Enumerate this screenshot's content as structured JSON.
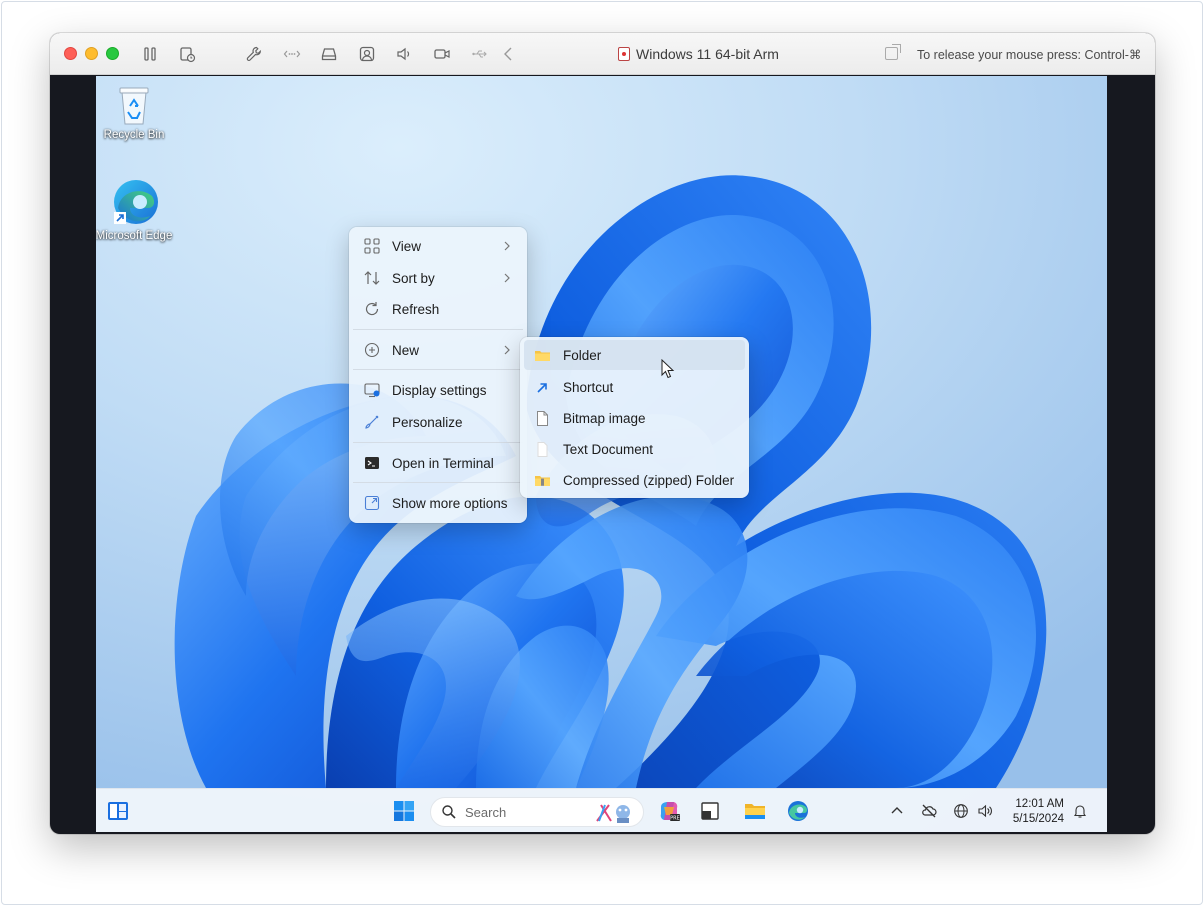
{
  "window": {
    "title": "Windows 11 64-bit Arm",
    "release_hint": "To release your mouse press: Control-⌘",
    "toolbar_icons": [
      "pause-icon",
      "snapshot-icon",
      "settings-wrench-icon",
      "network-icon",
      "disk-icon",
      "camera-sharing-icon",
      "sound-icon",
      "video-camera-icon",
      "usb-icon",
      "back-chevron-icon"
    ]
  },
  "desktop": {
    "icons": [
      {
        "label": "Recycle Bin",
        "icon": "recycle-bin-icon"
      },
      {
        "label": "Microsoft Edge",
        "icon": "edge-icon"
      }
    ]
  },
  "context_menu": {
    "items": [
      {
        "label": "View",
        "icon": "grid-view-icon",
        "has_submenu": true
      },
      {
        "label": "Sort by",
        "icon": "sort-icon",
        "has_submenu": true
      },
      {
        "label": "Refresh",
        "icon": "refresh-icon",
        "has_submenu": false
      },
      {
        "label": "New",
        "icon": "plus-circle-icon",
        "has_submenu": true
      },
      {
        "label": "Display settings",
        "icon": "display-icon",
        "has_submenu": false
      },
      {
        "label": "Personalize",
        "icon": "brush-icon",
        "has_submenu": false
      },
      {
        "label": "Open in Terminal",
        "icon": "terminal-icon",
        "has_submenu": false
      },
      {
        "label": "Show more options",
        "icon": "expand-icon",
        "has_submenu": false
      }
    ]
  },
  "new_submenu": {
    "items": [
      {
        "label": "Folder",
        "icon": "folder-icon",
        "highlighted": true
      },
      {
        "label": "Shortcut",
        "icon": "shortcut-arrow-icon"
      },
      {
        "label": "Bitmap image",
        "icon": "file-icon"
      },
      {
        "label": "Text Document",
        "icon": "text-document-icon"
      },
      {
        "label": "Compressed (zipped) Folder",
        "icon": "zip-folder-icon"
      }
    ]
  },
  "taskbar": {
    "search_placeholder": "Search",
    "apps": [
      "widgets-icon",
      "start-icon",
      "copilot-icon",
      "task-view-icon",
      "file-explorer-icon",
      "edge-icon"
    ],
    "tray": [
      "chevron-up-icon",
      "cloud-off-icon",
      "globe-icon",
      "volume-icon",
      "bell-icon"
    ],
    "time": "12:01 AM",
    "date": "5/15/2024"
  },
  "colors": {
    "accent": "#0067c0",
    "wallpaper_bg": "#c3dff6",
    "bloom": "#1a6ff0"
  }
}
